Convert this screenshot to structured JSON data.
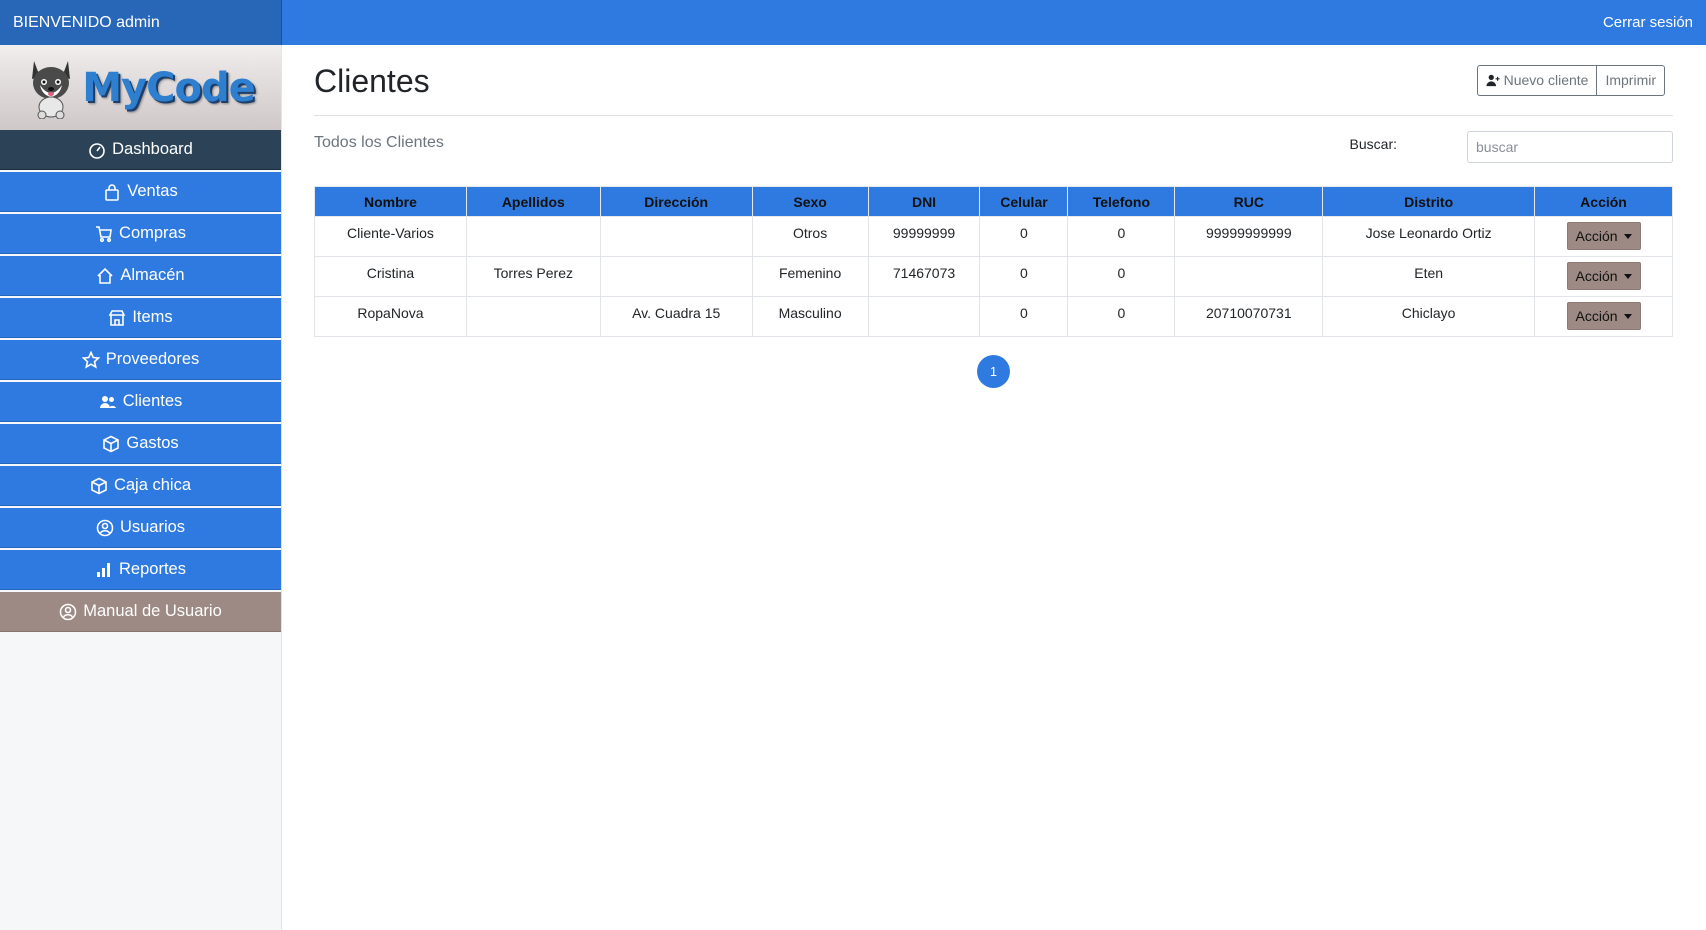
{
  "topbar": {
    "welcome": "BIENVENIDO admin",
    "logout": "Cerrar sesión"
  },
  "sidebar": {
    "logo_text": "MyCode",
    "items": [
      {
        "label": "Dashboard",
        "icon": "gauge-icon"
      },
      {
        "label": "Ventas",
        "icon": "shopping-bag-icon"
      },
      {
        "label": "Compras",
        "icon": "cart-icon"
      },
      {
        "label": "Almacén",
        "icon": "house-icon"
      },
      {
        "label": "Items",
        "icon": "store-icon"
      },
      {
        "label": "Proveedores",
        "icon": "star-icon"
      },
      {
        "label": "Clientes",
        "icon": "people-icon"
      },
      {
        "label": "Gastos",
        "icon": "box-icon"
      },
      {
        "label": "Caja chica",
        "icon": "box-icon"
      },
      {
        "label": "Usuarios",
        "icon": "user-circle-icon"
      },
      {
        "label": "Reportes",
        "icon": "bar-chart-icon"
      },
      {
        "label": "Manual de Usuario",
        "icon": "user-circle-icon"
      }
    ]
  },
  "main": {
    "title": "Clientes",
    "new_client_label": "Nuevo cliente",
    "print_label": "Imprimir",
    "subtitle": "Todos los Clientes",
    "search_label": "Buscar:",
    "search_placeholder": "buscar"
  },
  "table": {
    "headers": [
      "Nombre",
      "Apellidos",
      "Dirección",
      "Sexo",
      "DNI",
      "Celular",
      "Telefono",
      "RUC",
      "Distrito",
      "Acción"
    ],
    "rows": [
      [
        "Cliente-Varios",
        "",
        "",
        "Otros",
        "99999999",
        "0",
        "0",
        "99999999999",
        "Jose Leonardo Ortiz"
      ],
      [
        "Cristina",
        "Torres Perez",
        "",
        "Femenino",
        "71467073",
        "0",
        "0",
        "",
        "Eten"
      ],
      [
        "RopaNova",
        "",
        "Av. Cuadra 15",
        "Masculino",
        "",
        "0",
        "0",
        "20710070731",
        "Chiclayo"
      ]
    ],
    "action_label": "Acción"
  },
  "pagination": {
    "current_page": "1"
  },
  "colors": {
    "primary": "#2f7ae0",
    "active_nav": "#2b4257",
    "manual_nav": "#9d8a84",
    "action_button": "#9d8a84"
  }
}
